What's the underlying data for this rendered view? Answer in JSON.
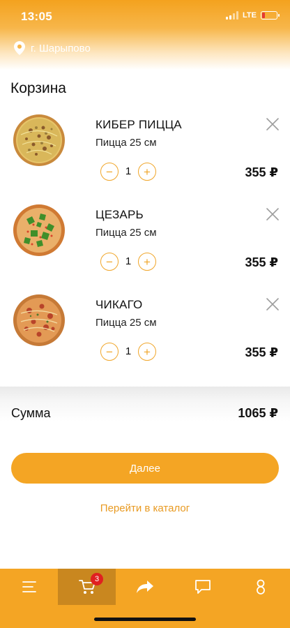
{
  "status_bar": {
    "time": "13:05",
    "network": "LTE"
  },
  "location": {
    "city": "г. Шарыпово"
  },
  "page_title": "Корзина",
  "cart": {
    "items": [
      {
        "name": "КИБЕР ПИЦЦА",
        "subtitle": "Пицца 25 см",
        "quantity": "1",
        "price": "355 ₽",
        "image": "cyber-pizza"
      },
      {
        "name": "ЦЕЗАРЬ",
        "subtitle": "Пицца 25 см",
        "quantity": "1",
        "price": "355 ₽",
        "image": "caesar-pizza"
      },
      {
        "name": "ЧИКАГО",
        "subtitle": "Пицца 25 см",
        "quantity": "1",
        "price": "355 ₽",
        "image": "chicago-pizza"
      }
    ]
  },
  "summary": {
    "label": "Сумма",
    "total": "1065 ₽"
  },
  "actions": {
    "next_label": "Далее",
    "catalog_label": "Перейти в каталог"
  },
  "tabbar": {
    "tabs": [
      {
        "icon": "menu-icon"
      },
      {
        "icon": "cart-icon",
        "badge": "3",
        "active": true
      },
      {
        "icon": "share-icon"
      },
      {
        "icon": "chat-icon"
      },
      {
        "icon": "profile-icon"
      }
    ]
  },
  "colors": {
    "accent": "#f4a524",
    "accent_dark": "#c9871f",
    "badge": "#e02020"
  }
}
